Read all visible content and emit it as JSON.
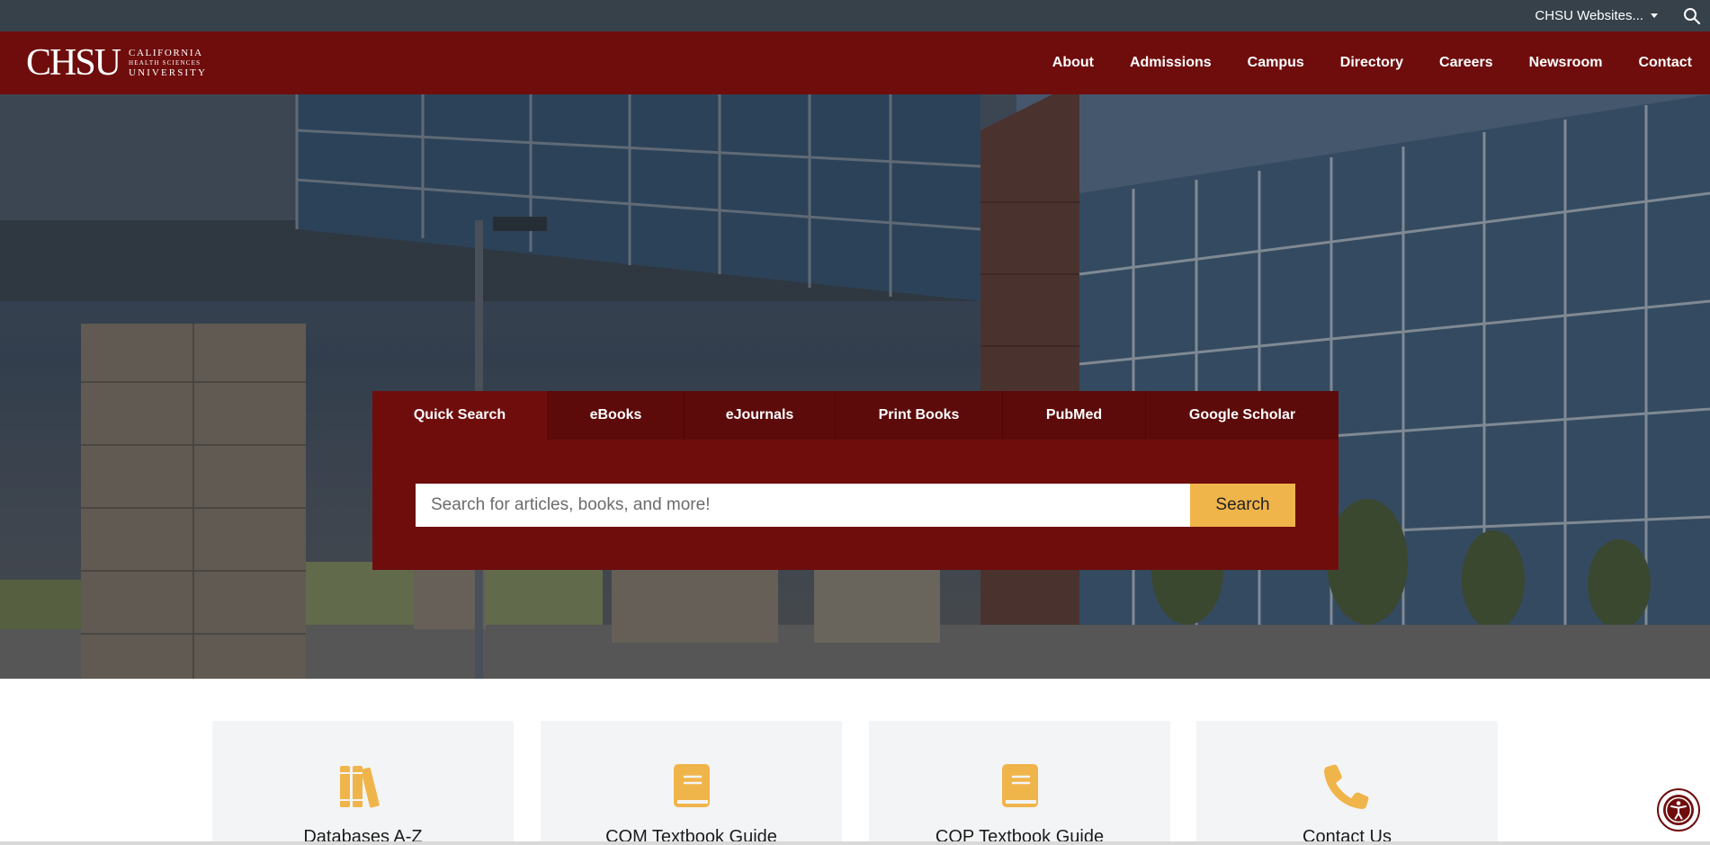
{
  "utility": {
    "websites_label": "CHSU Websites...",
    "search_icon": "search-icon"
  },
  "header": {
    "logo_mark": "CHSU",
    "logo_line1": "CALIFORNIA",
    "logo_line2": "HEALTH SCIENCES",
    "logo_line3": "UNIVERSITY",
    "nav": [
      "About",
      "Admissions",
      "Campus",
      "Directory",
      "Careers",
      "Newsroom",
      "Contact"
    ]
  },
  "search": {
    "tabs": [
      "Quick Search",
      "eBooks",
      "eJournals",
      "Print Books",
      "PubMed",
      "Google Scholar"
    ],
    "active_tab": "Quick Search",
    "placeholder": "Search for articles, books, and more!",
    "value": "",
    "button_label": "Search"
  },
  "quick_links": [
    {
      "label": "Databases A-Z",
      "icon": "books-icon"
    },
    {
      "label": "COM Textbook Guide",
      "icon": "book-icon"
    },
    {
      "label": "COP Textbook Guide",
      "icon": "book-icon"
    },
    {
      "label": "Contact Us",
      "icon": "phone-icon"
    }
  ],
  "colors": {
    "utility_bar": "#36414a",
    "brand_maroon": "#6f0d0d",
    "accent_gold": "#f0b54a",
    "card_bg": "#f3f4f6"
  },
  "accessibility_icon": "accessibility-icon"
}
